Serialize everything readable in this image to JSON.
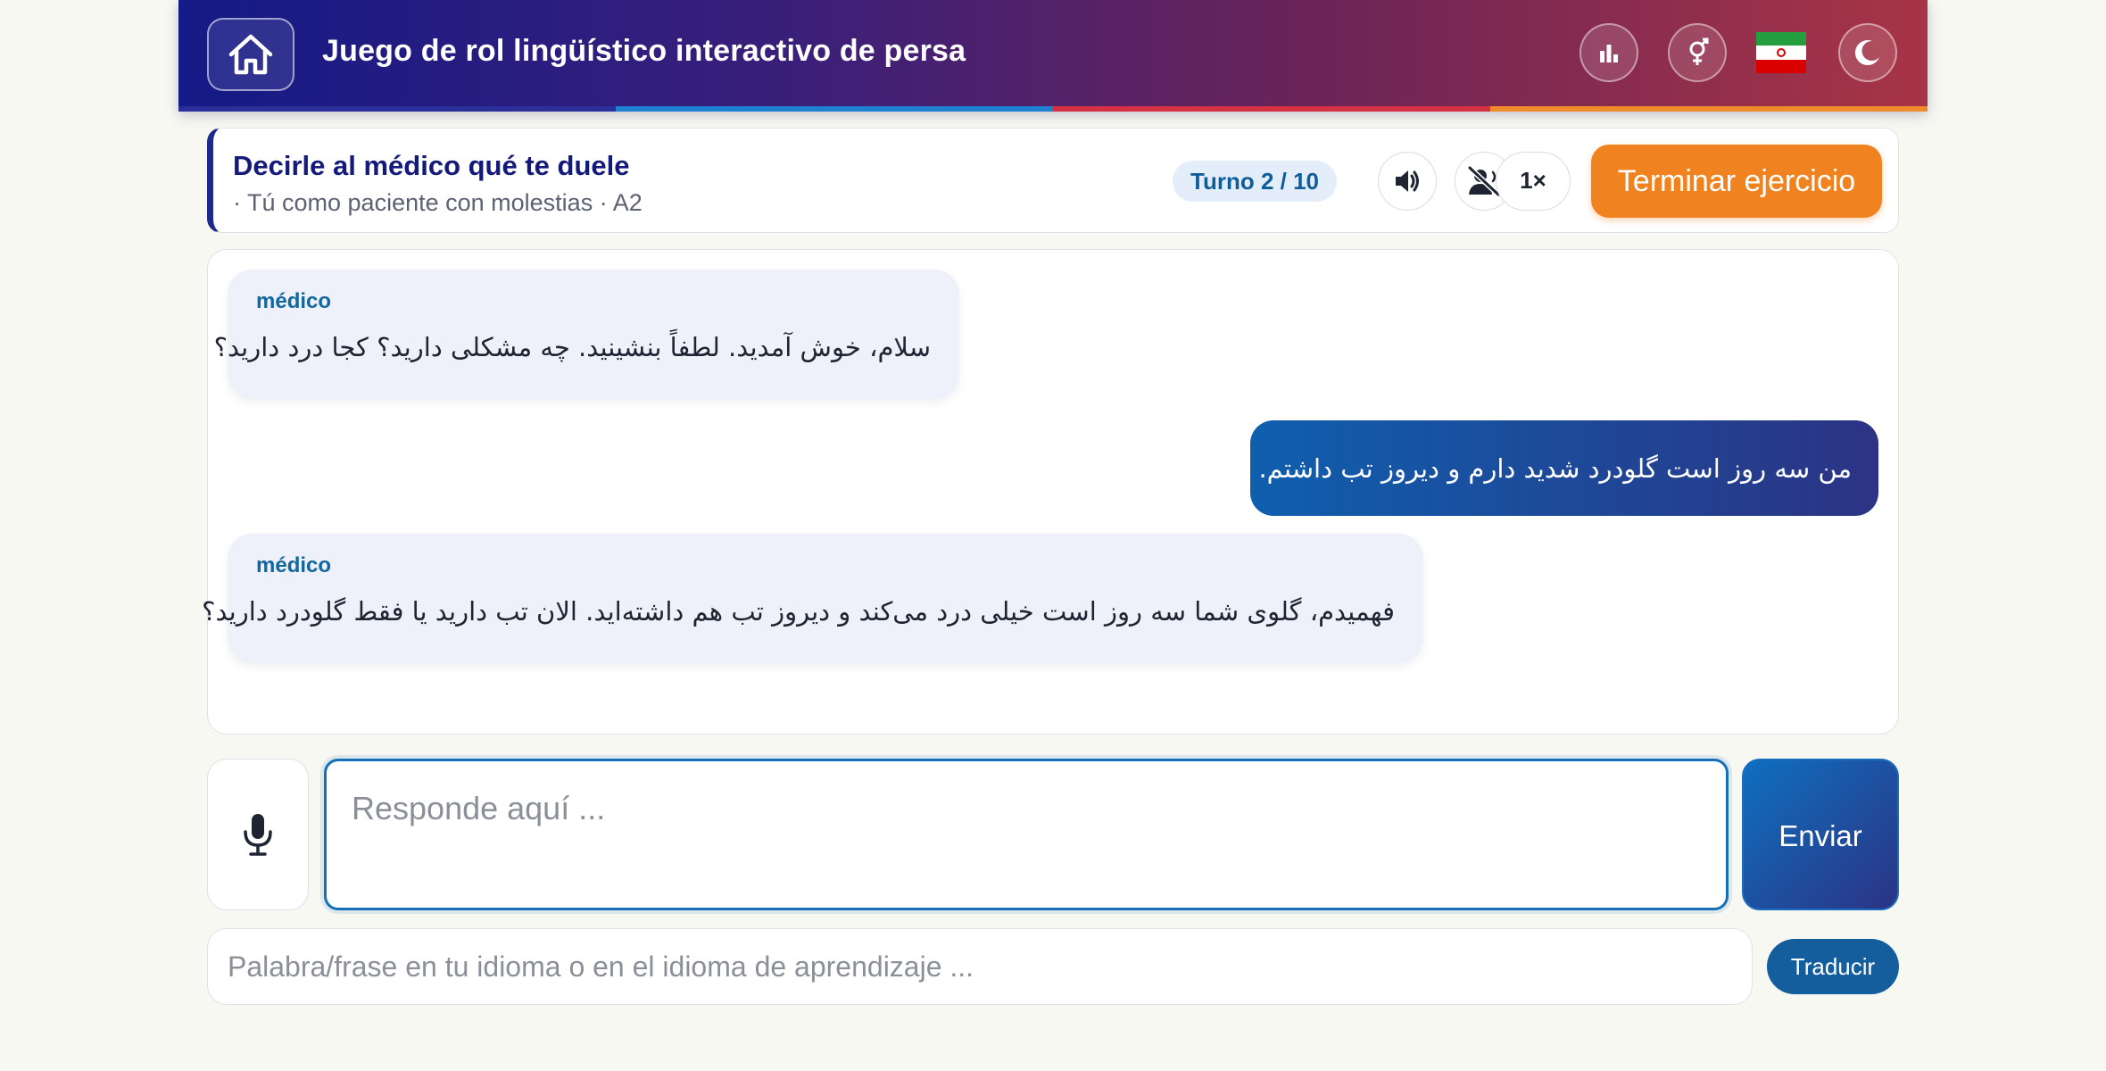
{
  "header": {
    "title": "Juego de rol lingüístico interactivo de persa",
    "home_icon": "home-icon",
    "stats_icon": "bar-chart-icon",
    "gender_icon": "gender-icon",
    "theme_icon": "moon-icon",
    "flag": "iran-flag",
    "stripe_colors": [
      "#2a2f9a",
      "#1f7fd1",
      "#d63045",
      "#ef8b2a"
    ]
  },
  "scenario": {
    "title": "Decirle al médico qué te duele",
    "subtitle": "· Tú como paciente con molestias · A2",
    "turn": "Turno 2 / 10",
    "speed": "1×",
    "finish_label": "Terminar ejercicio",
    "audio_icon": "speaker-icon",
    "mute_icon": "voice-off-icon"
  },
  "messages": [
    {
      "role": "partner",
      "speaker": "médico",
      "text": "سلام، خوش آمدید. لطفاً بنشینید. چه مشکلی دارید؟ کجا درد دارید؟"
    },
    {
      "role": "user",
      "text": "من سه روز است گلودرد شدید دارم و دیروز تب داشتم."
    },
    {
      "role": "partner",
      "speaker": "médico",
      "text": "فهمیدم، گلوی شما سه روز است خیلی درد می‌کند و دیروز تب هم داشته‌اید. الان تب دارید یا فقط گلودرد دارید؟"
    }
  ],
  "input": {
    "placeholder": "Responde aquí ...",
    "send_label": "Enviar",
    "mic_icon": "microphone-icon"
  },
  "translate": {
    "placeholder": "Palabra/frase en tu idioma o en el idioma de aprendizaje ...",
    "button_label": "Traducir"
  },
  "colors": {
    "accent": "#f0821f",
    "primary": "#141a86",
    "speaker": "#13679c"
  }
}
